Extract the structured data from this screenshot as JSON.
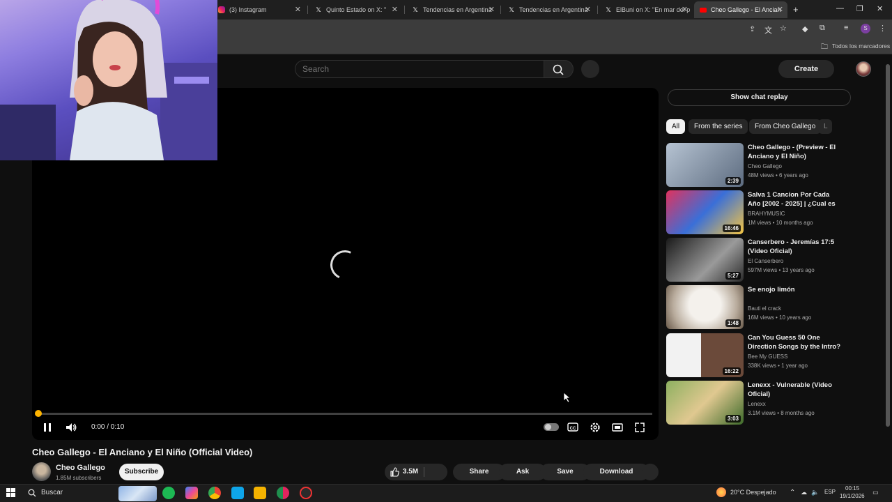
{
  "browser": {
    "tabs": [
      {
        "title": "(3) Instagram",
        "icon": "instagram-icon"
      },
      {
        "title": "Quinto Estado on X: \"",
        "icon": "x-icon"
      },
      {
        "title": "Tendencias en Argentina",
        "icon": "x-icon"
      },
      {
        "title": "Tendencias en Argentina",
        "icon": "x-icon"
      },
      {
        "title": "ElBuni on X: \"En mar del p",
        "icon": "x-icon"
      },
      {
        "title": "Cheo Gallego - El Ancian",
        "icon": "youtube-icon",
        "active": true
      }
    ],
    "bookmarks_label": "Todos los marcadores",
    "profile_initial": "S"
  },
  "youtube": {
    "search_placeholder": "Search",
    "create_label": "Create",
    "player": {
      "time": "0:00 / 0:10",
      "progress": 0.0
    },
    "video": {
      "title": "Cheo Gallego - El Anciano y El Niño (Official Video)",
      "channel": "Cheo Gallego",
      "subscribers": "1.85M subscribers",
      "subscribe_label": "Subscribe",
      "likes": "3.5M",
      "share_label": "Share",
      "ask_label": "Ask",
      "save_label": "Save",
      "download_label": "Download"
    },
    "sidebar": {
      "chat_replay": "Show chat replay",
      "chips": [
        "All",
        "From the series",
        "From Cheo Gallego",
        "L"
      ],
      "recommendations": [
        {
          "title": "Cheo Gallego - (Preview - El Anciano y El Niño)",
          "channel": "Cheo Gallego",
          "meta": "48M views • 6 years ago",
          "duration": "2:39",
          "thumb_color": "#8aa0b8"
        },
        {
          "title": "Salva 1 Cancion Por Cada Año [2002 - 2025] | ¿Cual es tu ...",
          "channel": "BRAHYMUSIC",
          "meta": "1M views • 10 months ago",
          "duration": "16:46",
          "thumb_color": "#c23a6a"
        },
        {
          "title": "Canserbero - Jeremías 17:5 (Video Oficial)",
          "channel": "El Canserbero",
          "meta": "597M views • 13 years ago",
          "duration": "5:27",
          "thumb_color": "#5a5a5a"
        },
        {
          "title": "Se enojo limón",
          "channel": "Bauti el crack",
          "meta": "16M views • 10 years ago",
          "duration": "1:48",
          "thumb_color": "#d8d2c8"
        },
        {
          "title": "Can You Guess 50 One Direction Songs by the Intro? ...",
          "channel": "Bee My GUESS",
          "meta": "338K views • 1 year ago",
          "duration": "16:22",
          "thumb_color": "#b84040"
        },
        {
          "title": "Lenexx - Vulnerable (Video Oficial)",
          "channel": "Lenexx",
          "meta": "3.1M views • 8 months ago",
          "duration": "3:03",
          "thumb_color": "#7d9a4a"
        }
      ]
    }
  },
  "taskbar": {
    "search_label": "Buscar",
    "weather": "20°C Despejado",
    "lang": "ESP",
    "time": "00:15",
    "date": "19/1/2026"
  }
}
